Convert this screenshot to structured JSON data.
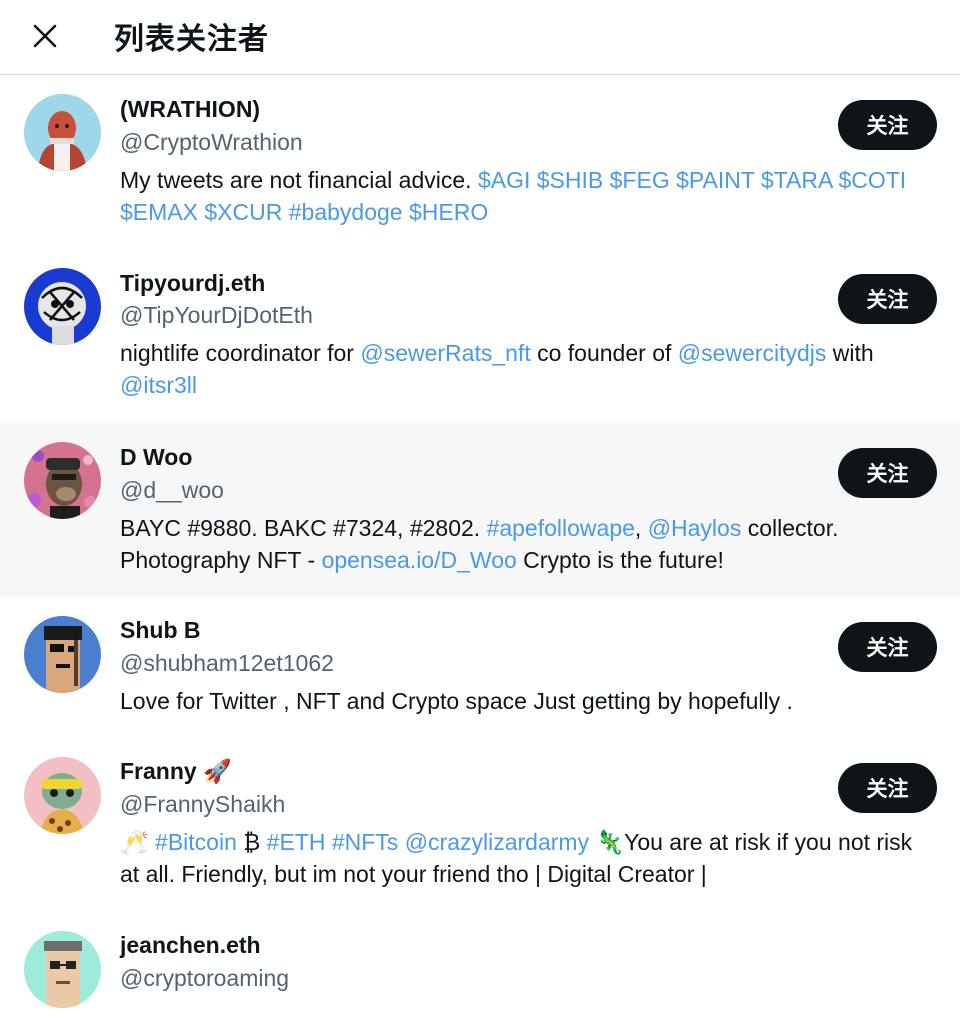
{
  "header": {
    "title": "列表关注者",
    "close_icon": "close-icon"
  },
  "users": [
    {
      "name": "(WRATHION)",
      "handle": "@CryptoWrathion",
      "follow_label": "关注",
      "bio_parts": [
        {
          "t": "My tweets are not financial advice. ",
          "link": false
        },
        {
          "t": "$AGI",
          "link": true
        },
        {
          "t": " ",
          "link": false
        },
        {
          "t": "$SHIB",
          "link": true
        },
        {
          "t": " ",
          "link": false
        },
        {
          "t": "$FEG",
          "link": true
        },
        {
          "t": " ",
          "link": false
        },
        {
          "t": "$PAINT",
          "link": true
        },
        {
          "t": " ",
          "link": false
        },
        {
          "t": "$TARA",
          "link": true
        },
        {
          "t": " ",
          "link": false
        },
        {
          "t": "$COTI",
          "link": true
        },
        {
          "t": " ",
          "link": false
        },
        {
          "t": "$EMAX",
          "link": true
        },
        {
          "t": " ",
          "link": false
        },
        {
          "t": "$XCUR",
          "link": true
        },
        {
          "t": " ",
          "link": false
        },
        {
          "t": "#babydoge",
          "link": true
        },
        {
          "t": " ",
          "link": false
        },
        {
          "t": "$HERO",
          "link": true
        }
      ]
    },
    {
      "name": "Tipyourdj.eth",
      "handle": "@TipYourDjDotEth",
      "follow_label": "关注",
      "bio_parts": [
        {
          "t": "nightlife coordinator for ",
          "link": false
        },
        {
          "t": "@sewerRats_nft",
          "link": true
        },
        {
          "t": " co founder of ",
          "link": false
        },
        {
          "t": "@sewercitydjs",
          "link": true
        },
        {
          "t": " with ",
          "link": false
        },
        {
          "t": "@itsr3ll",
          "link": true
        }
      ]
    },
    {
      "name": "D Woo",
      "handle": "@d__woo",
      "follow_label": "关注",
      "bio_parts": [
        {
          "t": "BAYC #9880. BAKC #7324, #2802. ",
          "link": false
        },
        {
          "t": "#apefollowape",
          "link": true
        },
        {
          "t": ", ",
          "link": false
        },
        {
          "t": "@Haylos",
          "link": true
        },
        {
          "t": " collector. Photography NFT - ",
          "link": false
        },
        {
          "t": "opensea.io/D_Woo",
          "link": true
        },
        {
          "t": " Crypto is the future!",
          "link": false
        }
      ]
    },
    {
      "name": "Shub B",
      "handle": "@shubham12et1062",
      "follow_label": "关注",
      "bio_parts": [
        {
          "t": "Love for Twitter , NFT and Crypto space Just getting by hopefully .",
          "link": false
        }
      ]
    },
    {
      "name": "Franny 🚀",
      "handle": "@FrannyShaikh",
      "follow_label": "关注",
      "bio_parts": [
        {
          "t": "🥂 ",
          "link": false
        },
        {
          "t": "#Bitcoin",
          "link": true
        },
        {
          "t": " ₿ ",
          "link": false
        },
        {
          "t": "#ETH",
          "link": true
        },
        {
          "t": " ",
          "link": false
        },
        {
          "t": "#NFTs",
          "link": true
        },
        {
          "t": " ",
          "link": false
        },
        {
          "t": "@crazylizardarmy",
          "link": true
        },
        {
          "t": " 🦎You are at risk if you not risk at all. Friendly, but im not your friend tho | Digital Creator |",
          "link": false
        }
      ]
    },
    {
      "name": "jeanchen.eth",
      "handle": "@cryptoroaming",
      "follow_label": "",
      "bio_parts": []
    }
  ],
  "colors": {
    "link": "#4a99e9",
    "button_bg": "#0f1419",
    "hover_row": "#f7f7f7"
  }
}
